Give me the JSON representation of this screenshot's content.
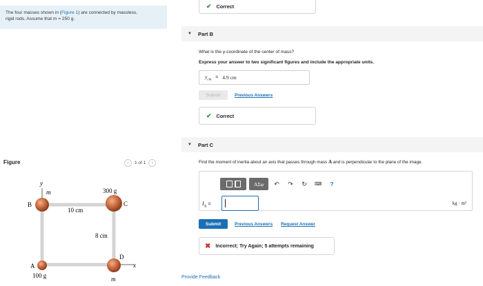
{
  "problem": {
    "line1_a": "The four masses shown in (",
    "line1_link": "Figure 1",
    "line1_b": ") are connected by massless,",
    "line2": "rigid rods. Assume that m = 250 g."
  },
  "figure": {
    "label": "Figure",
    "pager_text": "1 of 1",
    "prev_glyph": "‹",
    "next_glyph": "›",
    "masses": [
      {
        "id": "A",
        "label": "A",
        "mass_label": "100 g"
      },
      {
        "id": "B",
        "label": "B",
        "mass_label": "m"
      },
      {
        "id": "C",
        "label": "C",
        "mass_label": "300 g"
      },
      {
        "id": "D",
        "label": "D",
        "mass_label": "m"
      }
    ],
    "axis_x": "x",
    "axis_y": "y",
    "dim_horizontal": "10 cm",
    "dim_vertical": "8 cm",
    "mass_color": "#c96a3e",
    "rod_color": "#d0d0d0"
  },
  "part_a": {
    "feedback_text": "Correct"
  },
  "part_b": {
    "header": "Part B",
    "question": "What is the y-coordinate of the center of mass?",
    "instruction": "Express your answer to two significant figures and include the appropriate units.",
    "answer_var": "y",
    "answer_sub": "cm",
    "answer_eq": "=",
    "answer_value": "4.9 cm",
    "submit_label": "Submit",
    "previous_answers_label": "Previous Answers",
    "feedback_text": "Correct"
  },
  "part_c": {
    "header": "Part C",
    "question_a": "Find the moment of inertia about an axis that passes through mass ",
    "question_mass": "A",
    "question_b": " and is perpendicular to the plane of the image.",
    "toolbar": {
      "greek_label": "ΑΣφ",
      "undo_glyph": "↶",
      "redo_glyph": "↷",
      "reset_glyph": "↻",
      "keyboard_glyph": "⌨",
      "help_glyph": "?"
    },
    "input_var": "I",
    "input_sub": "A",
    "input_eq": "=",
    "units": "kg · m²",
    "submit_label": "Submit",
    "previous_answers_label": "Previous Answers",
    "request_answer_label": "Request Answer",
    "feedback_text": "Incorrect; Try Again; 5 attempts remaining"
  },
  "footer": {
    "provide_feedback": "Provide Feedback"
  },
  "colors": {
    "accent": "#1a6fb5",
    "correct": "#2f8f3a",
    "incorrect": "#d0322b",
    "problem_bg": "#e6f1f7"
  }
}
